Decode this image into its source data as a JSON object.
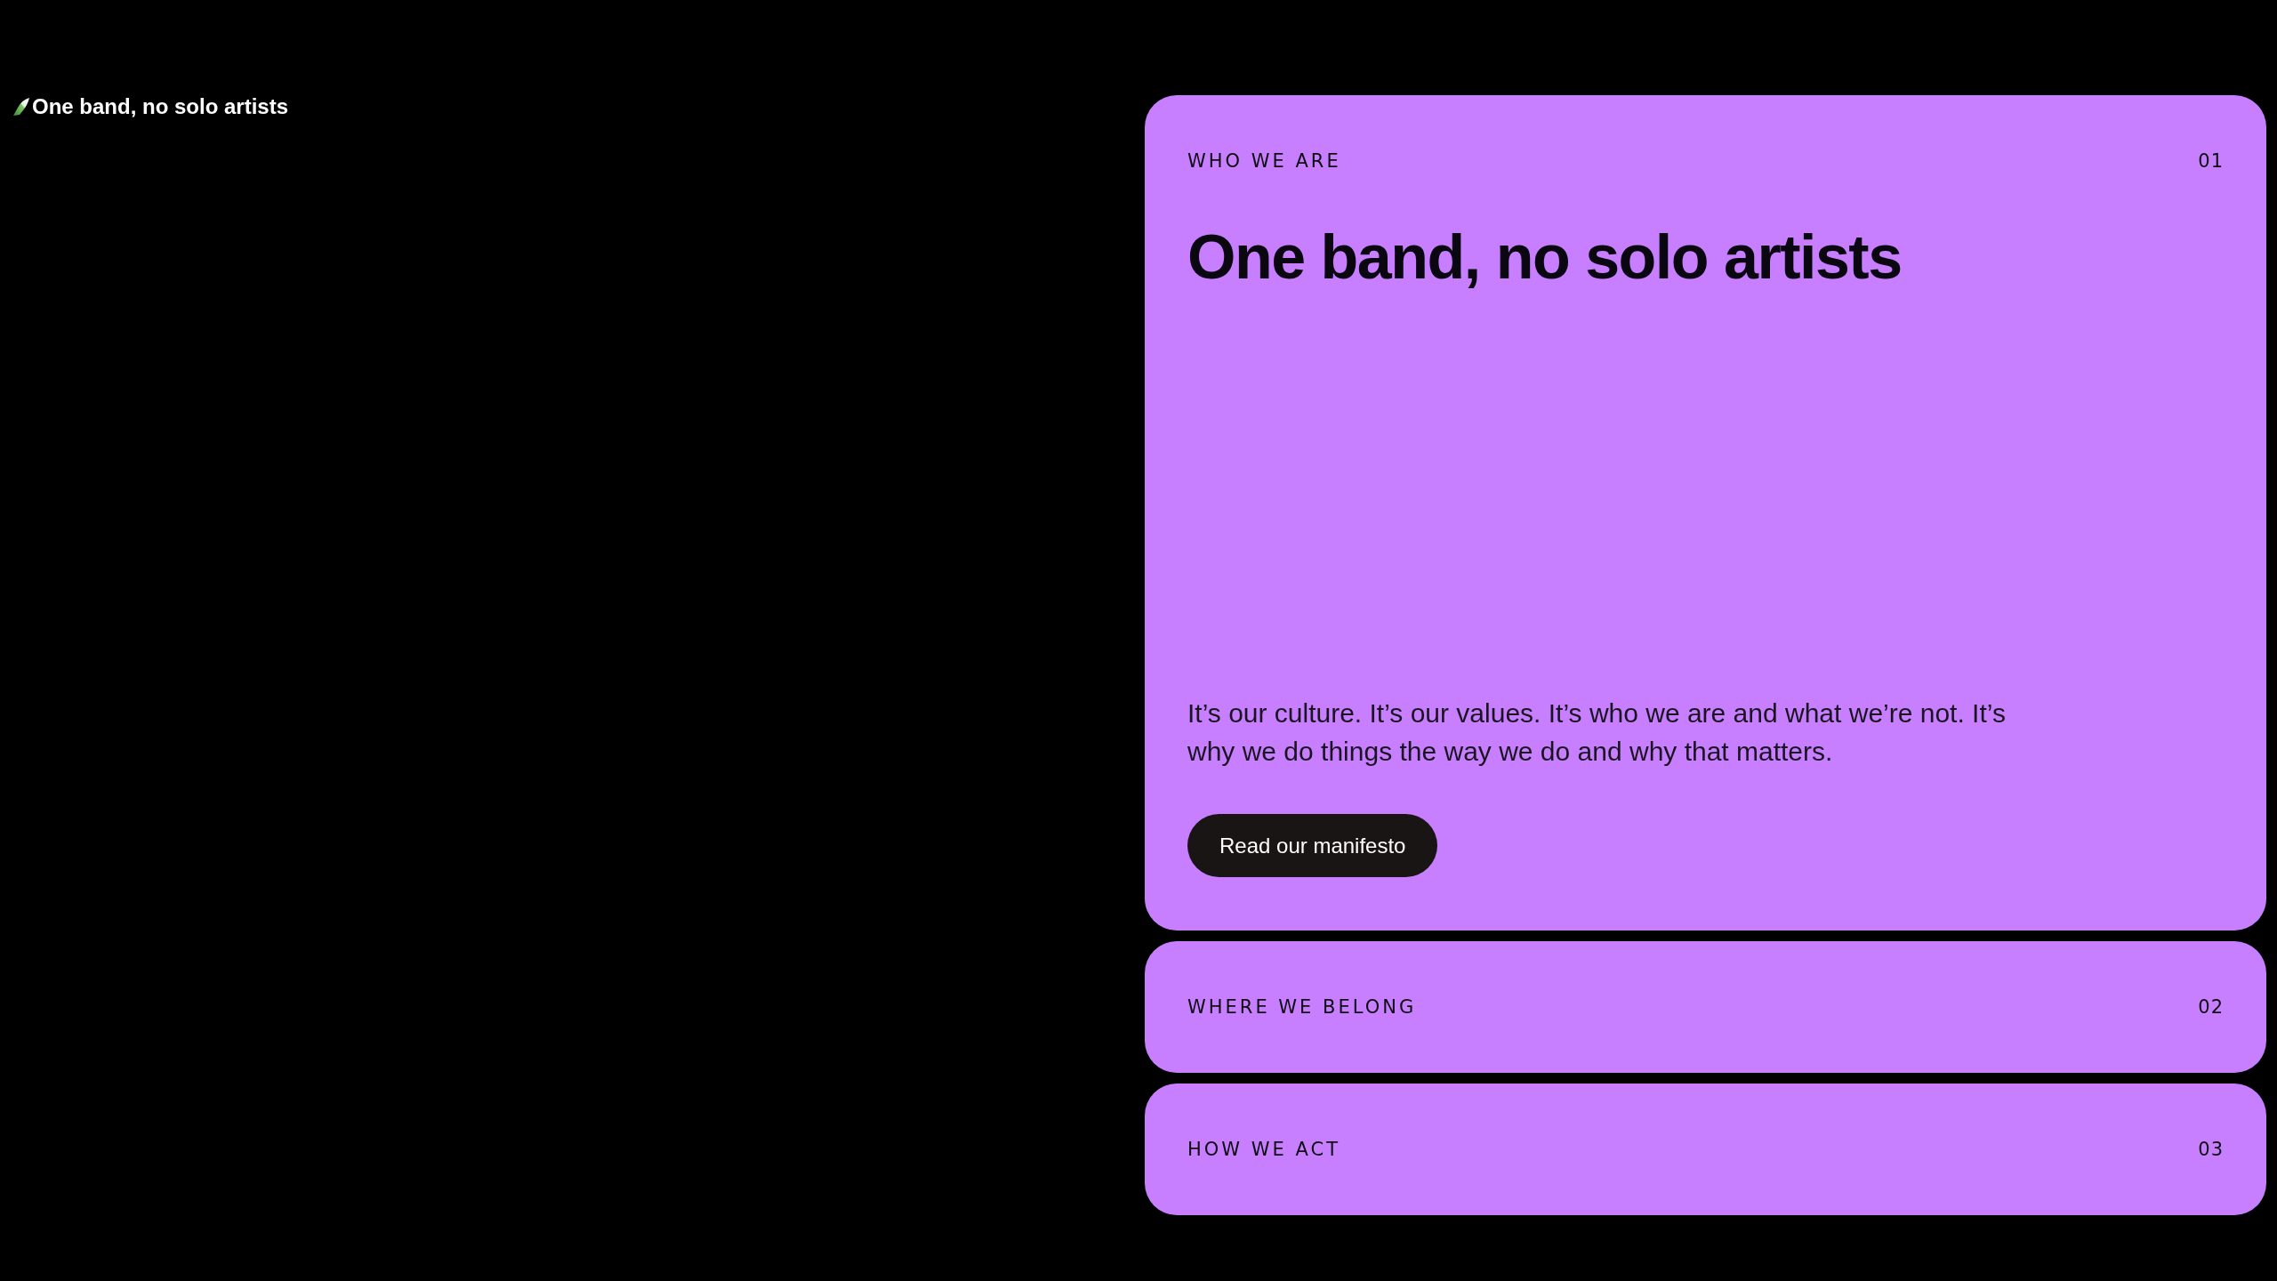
{
  "logo": {
    "text": "One band, no solo artists"
  },
  "sections": [
    {
      "label": "WHO WE ARE",
      "number": "01",
      "expanded": true,
      "heading": "One band, no solo artists",
      "body": "It’s our culture. It’s our values. It’s who we are and what we’re not. It’s why we do things the way we do and why that matters.",
      "button": "Read our manifesto"
    },
    {
      "label": "WHERE WE BELONG",
      "number": "02",
      "expanded": false
    },
    {
      "label": "HOW WE ACT",
      "number": "03",
      "expanded": false
    }
  ]
}
